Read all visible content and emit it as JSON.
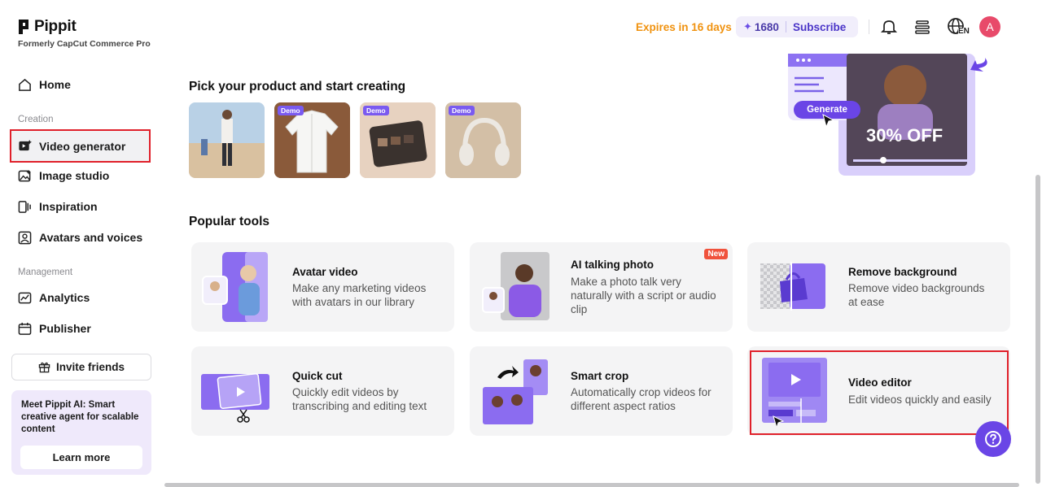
{
  "brand": {
    "name": "Pippit",
    "subtitle": "Formerly CapCut Commerce Pro"
  },
  "sidebar": {
    "home": "Home",
    "creation_label": "Creation",
    "creation_items": [
      "Video generator",
      "Image studio",
      "Inspiration",
      "Avatars and voices"
    ],
    "management_label": "Management",
    "management_items": [
      "Analytics",
      "Publisher"
    ],
    "invite": "Invite friends",
    "promo_text": "Meet Pippit AI: Smart creative agent for scalable content",
    "learn_more": "Learn more"
  },
  "header": {
    "expires": "Expires in 16 days",
    "credits": "1680",
    "subscribe": "Subscribe",
    "avatar_letter": "A",
    "lang_code": "EN"
  },
  "products": {
    "title": "Pick your product and start creating",
    "demo_label": "Demo"
  },
  "banner": {
    "generate": "Generate",
    "offer": "30% OFF"
  },
  "tools": {
    "title": "Popular tools",
    "new_label": "New",
    "items": [
      {
        "title": "Avatar video",
        "desc": "Make any marketing videos with avatars in our library"
      },
      {
        "title": "AI talking photo",
        "desc": "Make a photo talk very naturally with a script or audio clip"
      },
      {
        "title": "Remove background",
        "desc": "Remove video backgrounds at ease"
      },
      {
        "title": "Quick cut",
        "desc": "Quickly edit videos by transcribing and editing text"
      },
      {
        "title": "Smart crop",
        "desc": "Automatically crop videos for different aspect ratios"
      },
      {
        "title": "Video editor",
        "desc": "Edit videos quickly and easily"
      }
    ]
  },
  "colors": {
    "accent": "#6a45e6",
    "expires": "#f0920f",
    "highlight": "#e0202a"
  }
}
